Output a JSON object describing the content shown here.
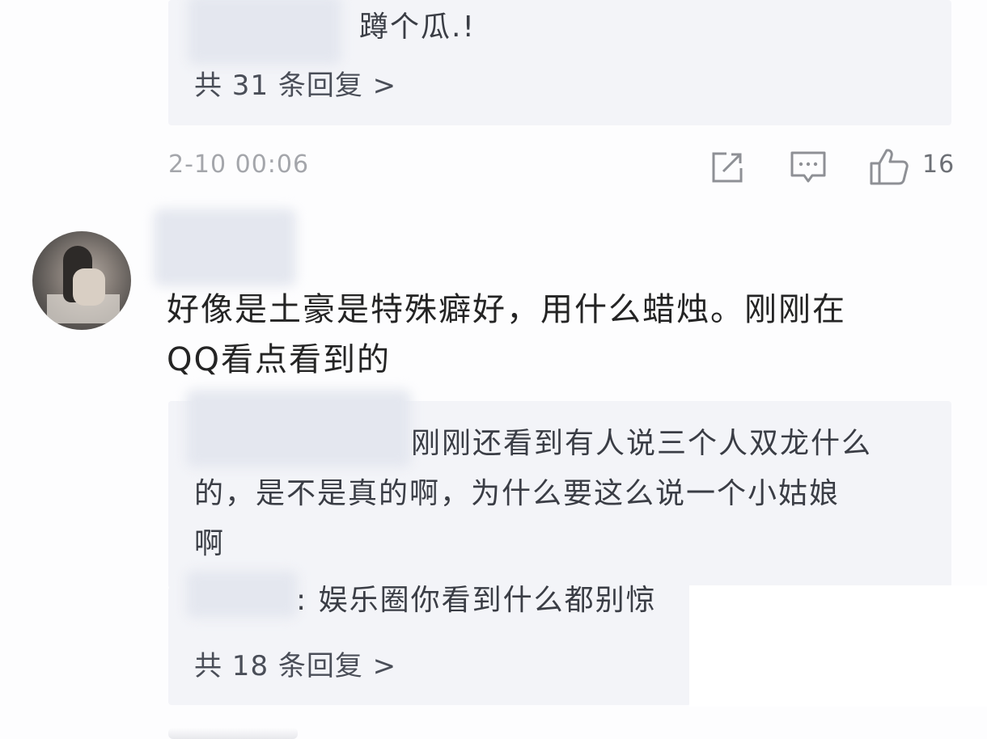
{
  "top_thread": {
    "reply_snippet": "蹲个瓜.!",
    "more_replies_label": "共 31 条回复 >"
  },
  "top_comment_meta": {
    "timestamp": "2-10 00:06",
    "like_count": "16"
  },
  "comment": {
    "text_line1": "好像是土豪是特殊癖好，用什么蜡烛。刚刚在",
    "text_line2": "QQ看点看到的",
    "replies": [
      {
        "line1": "刚刚还看到有人说三个人双龙什么",
        "line2": "的，是不是真的啊，为什么要这么说一个小姑娘",
        "line3": "啊"
      },
      {
        "text": ": 娱乐圈你看到什么都别惊"
      }
    ],
    "more_replies_label": "共 18 条回复 >"
  },
  "icons": {
    "share": "share-icon",
    "comment": "comment-icon",
    "like": "thumbs-up-icon"
  },
  "colors": {
    "background": "#fdfdfe",
    "reply_box": "#f3f4f8",
    "meta_text": "#a4a6ab"
  }
}
